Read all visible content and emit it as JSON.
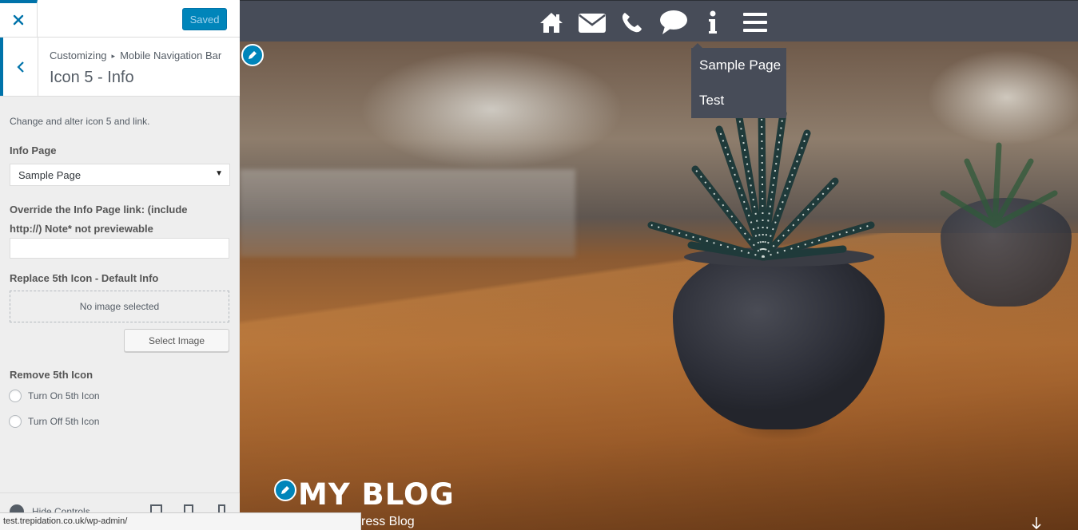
{
  "header": {
    "close_label": "×",
    "save_label": "Saved"
  },
  "section": {
    "breadcrumb_root": "Customizing",
    "breadcrumb_sep": "▸",
    "breadcrumb_parent": "Mobile Navigation Bar",
    "title": "Icon 5 - Info"
  },
  "controls": {
    "description": "Change and alter icon 5 and link.",
    "info_page_label": "Info Page",
    "info_page_value": "Sample Page",
    "override_label": "Override the Info Page link: (include http://) Note* not previewable",
    "override_value": "",
    "replace_label": "Replace 5th Icon - Default Info",
    "no_image_text": "No image selected",
    "select_image_label": "Select Image",
    "remove_label": "Remove 5th Icon",
    "radio_on_label": "Turn On 5th Icon",
    "radio_off_label": "Turn Off 5th Icon"
  },
  "footer": {
    "hide_controls_label": "Hide Controls"
  },
  "status_bar": {
    "url": "test.trepidation.co.uk/wp-admin/"
  },
  "preview": {
    "nav_icons": [
      "home-icon",
      "envelope-icon",
      "phone-icon",
      "comment-icon",
      "info-icon",
      "menu-icon"
    ],
    "dropdown_items": [
      "Sample Page",
      "Test"
    ],
    "site_title": "MY BLOG",
    "site_tagline": "ress Blog"
  },
  "colors": {
    "accent": "#0073aa",
    "button": "#0085ba",
    "nav_bg": "#474c58"
  }
}
